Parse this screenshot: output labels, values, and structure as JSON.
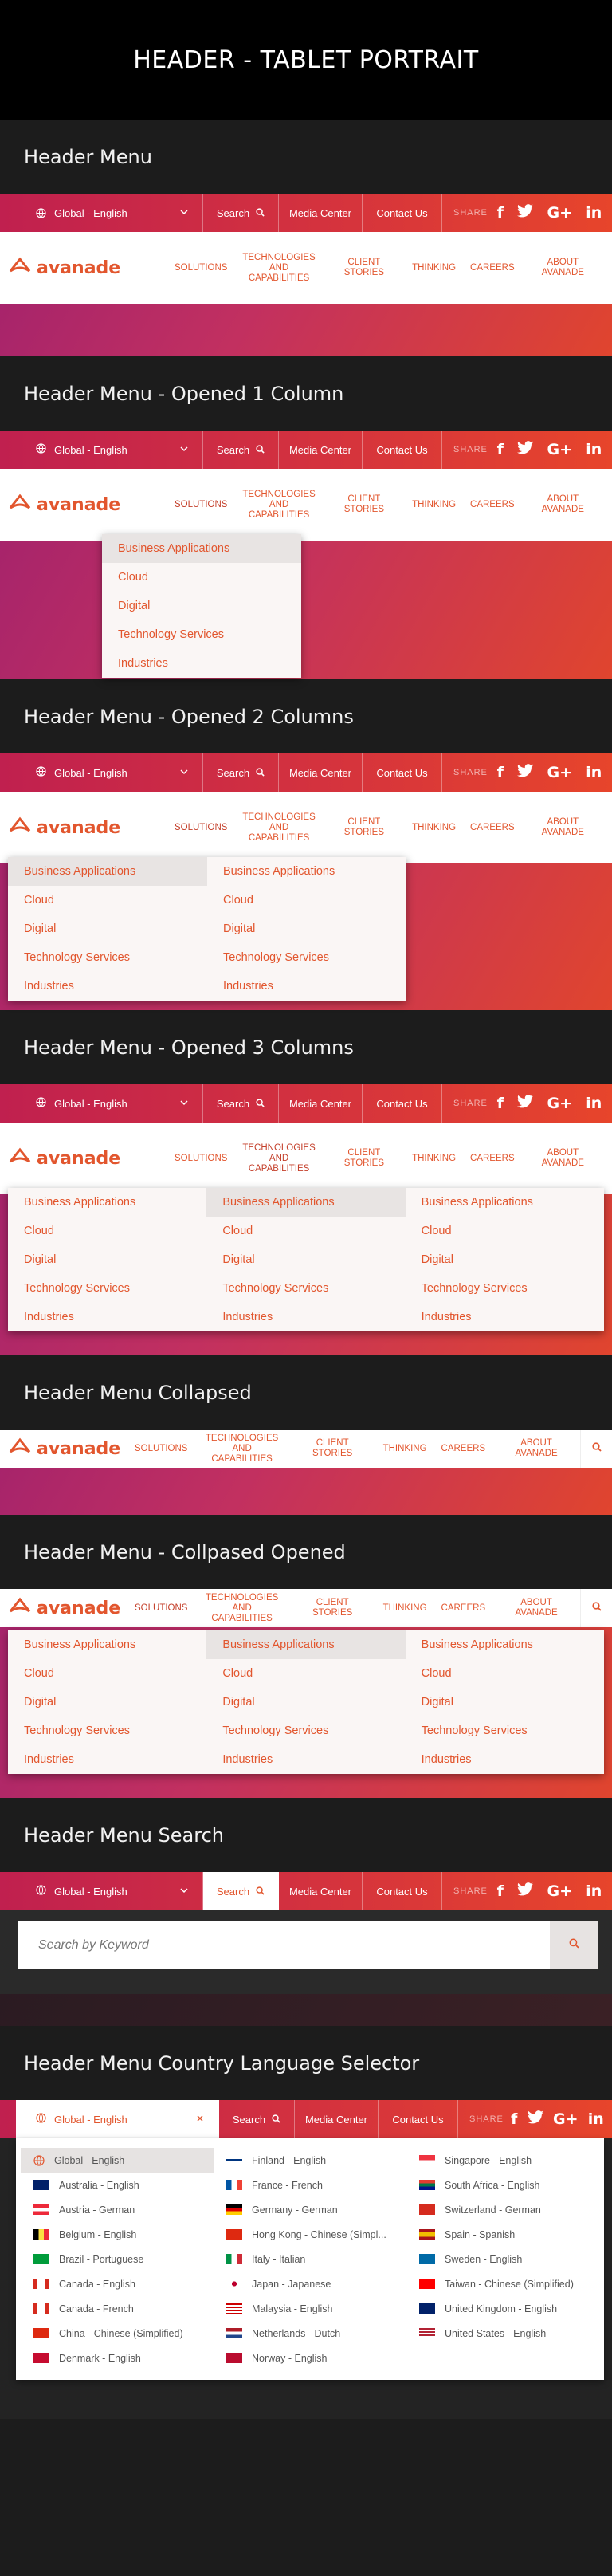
{
  "page_title": "HEADER - TABLET PORTRAIT",
  "sections": {
    "s1": "Header Menu",
    "s2": "Header Menu - Opened 1 Column",
    "s3": "Header Menu - Opened 2 Columns",
    "s4": "Header Menu - Opened 3 Columns",
    "s5": "Header Menu Collapsed",
    "s6": "Header Menu - Collpased Opened",
    "s7": "Header Menu Search",
    "s8": "Header Menu Country Language Selector"
  },
  "topbar": {
    "global": "Global - English",
    "search": "Search",
    "media": "Media Center",
    "contact": "Contact Us",
    "share": "SHARE",
    "social": [
      "f",
      "t",
      "G+",
      "in"
    ]
  },
  "logo": "avanade",
  "nav": {
    "solutions": "SOLUTIONS",
    "tech1": "TECHNOLOGIES",
    "tech2": "AND CAPABILITIES",
    "client": "CLIENT STORIES",
    "thinking": "THINKING",
    "careers": "CAREERS",
    "about": "ABOUT AVANADE"
  },
  "menu": [
    "Business Applications",
    "Cloud",
    "Digital",
    "Technology Services",
    "Industries"
  ],
  "search_placeholder": "Search by Keyword",
  "countries": {
    "col1": [
      "Global - English",
      "Australia - English",
      "Austria - German",
      "Belgium - English",
      "Brazil - Portuguese",
      "Canada - English",
      "Canada - French",
      "China - Chinese (Simplified)",
      "Denmark - English"
    ],
    "col2": [
      "Finland - English",
      "France - French",
      "Germany - German",
      "Hong Kong - Chinese (Simpl...",
      "Italy - Italian",
      "Japan - Japanese",
      "Malaysia - English",
      "Netherlands - Dutch",
      "Norway - English"
    ],
    "col3": [
      "Singapore - English",
      "South Africa - English",
      "Switzerland - German",
      "Spain - Spanish",
      "Sweden - English",
      "Taiwan - Chinese (Simplified)",
      "United Kingdom - English",
      "United States - English"
    ]
  },
  "colors": {
    "accent": "#e2562e",
    "bar_start": "#c0204f",
    "bar_end": "#e7452b"
  }
}
